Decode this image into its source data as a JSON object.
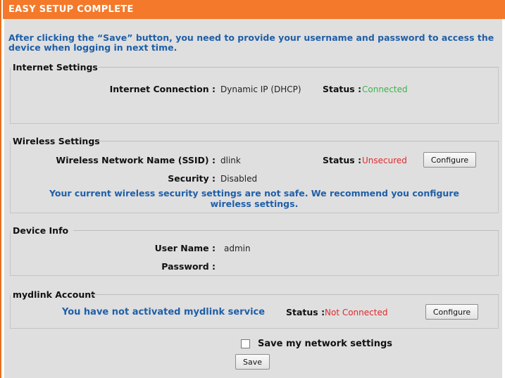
{
  "header": {
    "title": "EASY SETUP COMPLETE"
  },
  "intro": "After clicking the “Save” button, you need to provide your username and password to access the device when logging in next time.",
  "internet": {
    "heading": "Internet Settings",
    "connection_label": "Internet Connection :",
    "connection_value": "Dynamic IP (DHCP)",
    "status_label": "Status :",
    "status_value": "Connected"
  },
  "wireless": {
    "heading": "Wireless Settings",
    "ssid_label": "Wireless Network Name (SSID) :",
    "ssid_value": "dlink",
    "status_label": "Status :",
    "status_value": "Unsecured",
    "configure_label": "Configure",
    "security_label": "Security :",
    "security_value": "Disabled",
    "warning": "Your current wireless security settings are not safe. We recommend you configure wireless settings."
  },
  "device": {
    "heading": "Device Info",
    "username_label": "User Name :",
    "username_value": "admin",
    "password_label": "Password :",
    "password_value": ""
  },
  "mydlink": {
    "heading": "mydlink Account",
    "message": "You have not activated mydlink service",
    "status_label": "Status :",
    "status_value": "Not Connected",
    "configure_label": "Configure"
  },
  "footer": {
    "save_settings_label": "Save my network settings",
    "save_settings_checked": false,
    "save_button_label": "Save"
  },
  "colors": {
    "accent": "#f4792a",
    "info_text": "#1f5fa8",
    "connected": "#3cb44a",
    "warning": "#e1282d"
  }
}
